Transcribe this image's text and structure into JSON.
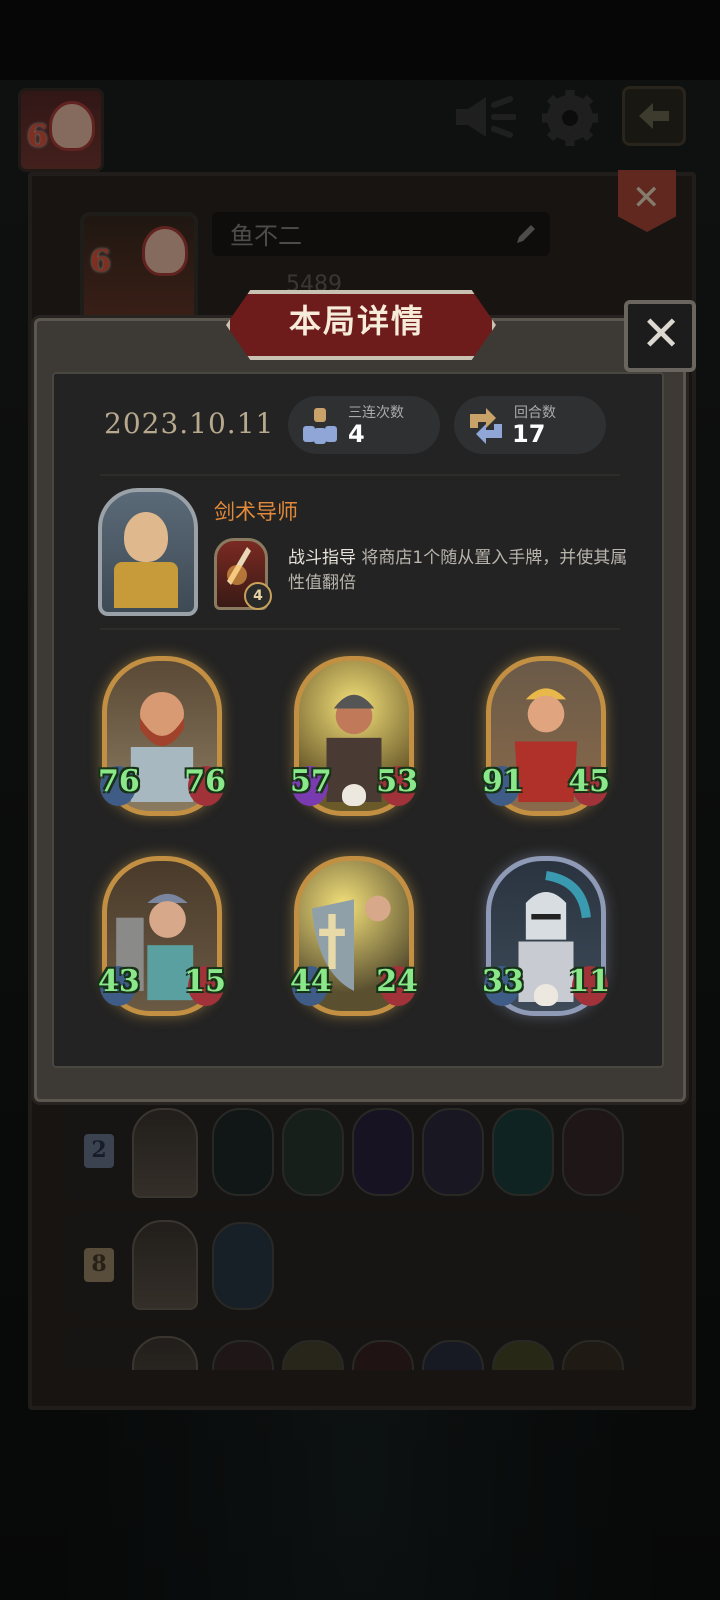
{
  "profile": {
    "avatar_level": "6",
    "name": "鱼不二",
    "score": "5489"
  },
  "modal": {
    "title": "本局详情",
    "date": "2023.10.11",
    "stats": [
      {
        "label": "三连次数",
        "value": "4",
        "icon": "triple-icon"
      },
      {
        "label": "回合数",
        "value": "17",
        "icon": "rounds-icon"
      }
    ],
    "hero": {
      "name": "剑术导师",
      "skill_name": "战斗指导",
      "skill_desc": "将商店1个随从置入手牌，并使其属性值翻倍",
      "skill_cost": "4"
    },
    "cards": [
      {
        "atk": "76",
        "hp": "76",
        "art": "bearded-brawler",
        "frame": "gold",
        "skull": false
      },
      {
        "atk": "57",
        "hp": "53",
        "art": "hooded-fighter",
        "frame": "gold",
        "skull": true
      },
      {
        "atk": "91",
        "hp": "45",
        "art": "blonde-warrior",
        "frame": "gold",
        "skull": false
      },
      {
        "atk": "43",
        "hp": "15",
        "art": "shield-bearer",
        "frame": "gold",
        "skull": false
      },
      {
        "atk": "44",
        "hp": "24",
        "art": "holy-shield",
        "frame": "gold",
        "skull": false
      },
      {
        "atk": "33",
        "hp": "11",
        "art": "armored-knight",
        "frame": "silver",
        "skull": true
      }
    ]
  },
  "history_rows": [
    {
      "rank": "2"
    },
    {
      "rank": "8"
    },
    {
      "rank": ""
    }
  ],
  "colors": {
    "accent_orange": "#e28a3a",
    "stat_green": "#8ae88a",
    "banner_red": "#6e1b1b",
    "gold_frame": "#c39043"
  }
}
